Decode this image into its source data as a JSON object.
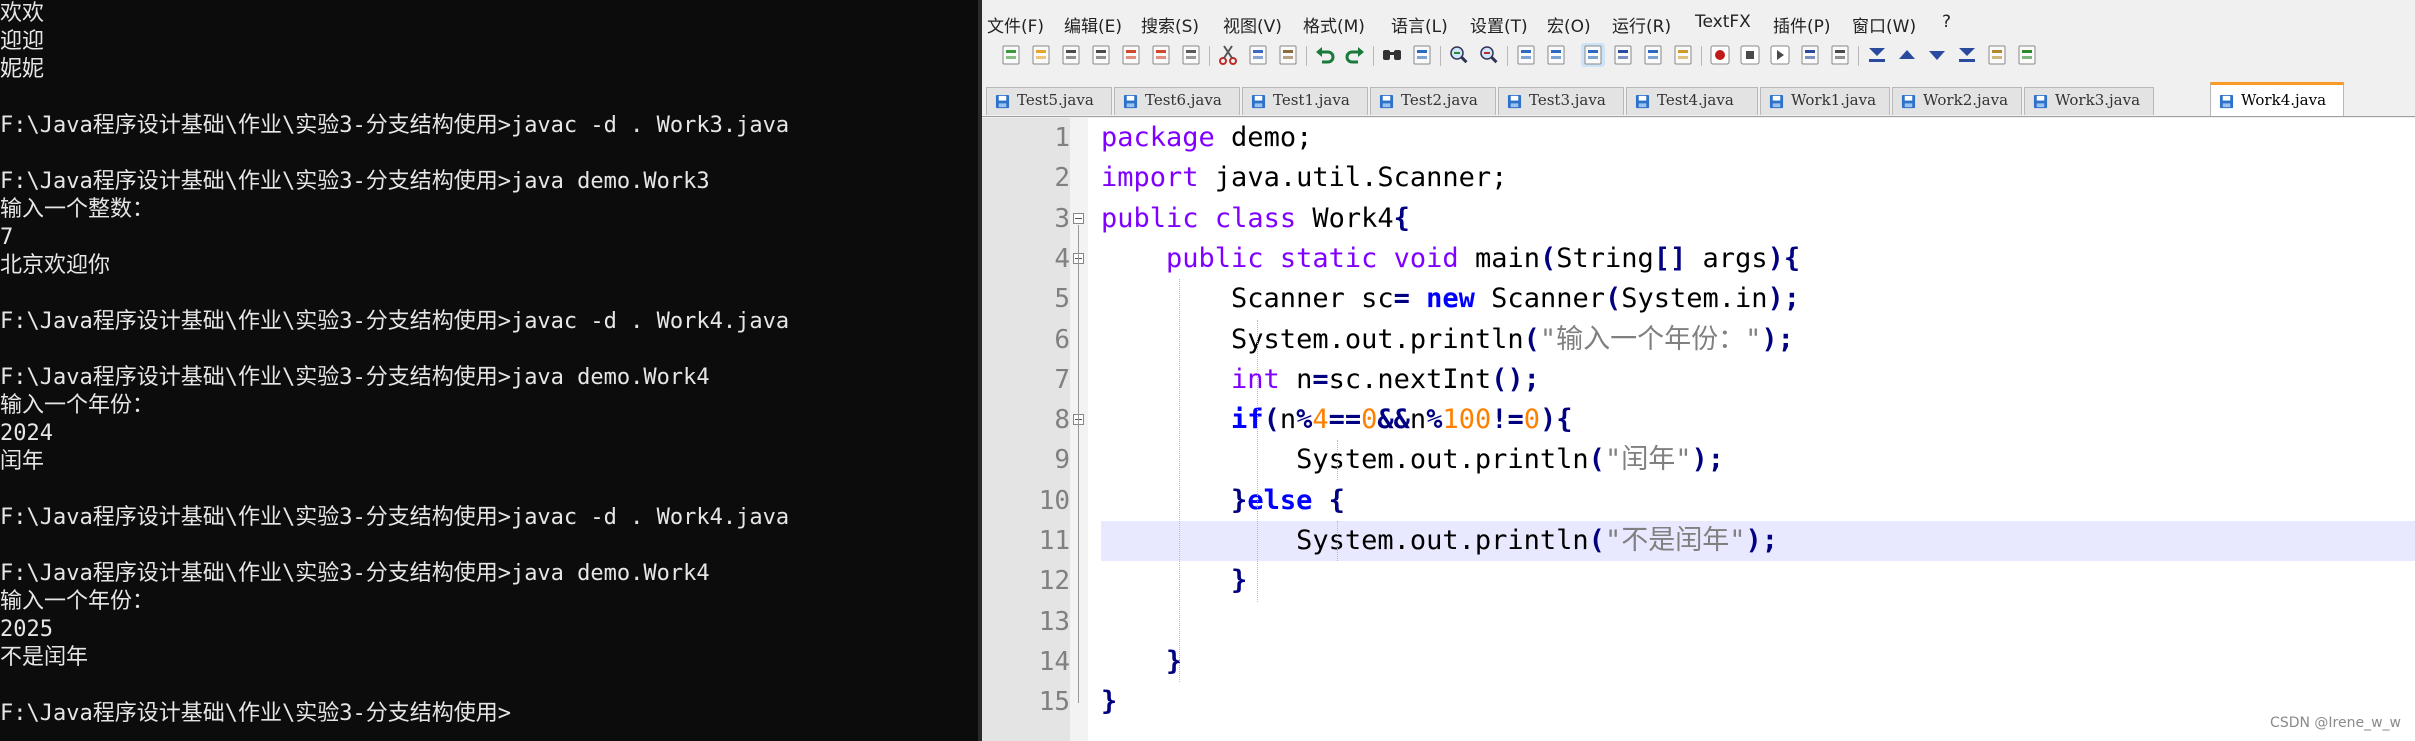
{
  "console": {
    "lines": [
      "欢欢",
      "迎迎",
      "妮妮",
      "",
      "F:\\Java程序设计基础\\作业\\实验3-分支结构使用>javac -d . Work3.java",
      "",
      "F:\\Java程序设计基础\\作业\\实验3-分支结构使用>java demo.Work3",
      "输入一个整数：",
      "7",
      "北京欢迎你",
      "",
      "F:\\Java程序设计基础\\作业\\实验3-分支结构使用>javac -d . Work4.java",
      "",
      "F:\\Java程序设计基础\\作业\\实验3-分支结构使用>java demo.Work4",
      "输入一个年份：",
      "2024",
      "闰年",
      "",
      "F:\\Java程序设计基础\\作业\\实验3-分支结构使用>javac -d . Work4.java",
      "",
      "F:\\Java程序设计基础\\作业\\实验3-分支结构使用>java demo.Work4",
      "输入一个年份：",
      "2025",
      "不是闰年",
      "",
      "F:\\Java程序设计基础\\作业\\实验3-分支结构使用>"
    ]
  },
  "editor": {
    "menu": [
      "文件(F)",
      "编辑(E)",
      "搜索(S)",
      "视图(V)",
      "格式(M)",
      "语言(L)",
      "设置(T)",
      "宏(O)",
      "运行(R)",
      "TextFX",
      "插件(P)",
      "窗口(W)",
      "?"
    ],
    "toolbar": {
      "icons": [
        "new-file-icon",
        "open-file-icon",
        "save-icon",
        "save-all-icon",
        "close-icon",
        "close-all-icon",
        "print-icon",
        "cut-icon",
        "copy-icon",
        "paste-icon",
        "undo-icon",
        "redo-icon",
        "find-icon",
        "replace-icon",
        "zoom-in-icon",
        "zoom-out-icon",
        "sync-vertical-icon",
        "sync-horizontal-icon",
        "word-wrap-icon",
        "show-all-chars-icon",
        "indent-guide-icon",
        "user-language-icon",
        "record-macro-icon",
        "stop-macro-icon",
        "play-macro-icon",
        "run-macro-multiple-icon",
        "save-macro-icon",
        "sort-ascending-icon",
        "up-icon",
        "down-icon",
        "sort-descending-icon",
        "launch-browser-icon",
        "spell-check-icon"
      ]
    },
    "tabs": [
      {
        "label": "Test5.java",
        "active": false
      },
      {
        "label": "Test6.java",
        "active": false
      },
      {
        "label": "Test1.java",
        "active": false
      },
      {
        "label": "Test2.java",
        "active": false
      },
      {
        "label": "Test3.java",
        "active": false
      },
      {
        "label": "Test4.java",
        "active": false
      },
      {
        "label": "Work1.java",
        "active": false
      },
      {
        "label": "Work2.java",
        "active": false
      },
      {
        "label": "Work3.java",
        "active": false
      },
      {
        "label": "Work4.java",
        "active": true
      }
    ],
    "line_numbers": [
      "1",
      "2",
      "3",
      "4",
      "5",
      "6",
      "7",
      "8",
      "9",
      "10",
      "11",
      "12",
      "13",
      "14",
      "15"
    ],
    "code": [
      [
        [
          "kw",
          "package"
        ],
        [
          "t",
          " demo;"
        ]
      ],
      [
        [
          "kw",
          "import"
        ],
        [
          "t",
          " java.util.Scanner;"
        ]
      ],
      [
        [
          "kw",
          "public"
        ],
        [
          "t",
          " "
        ],
        [
          "kw",
          "class"
        ],
        [
          "t",
          " Work4"
        ],
        [
          "op",
          "{"
        ]
      ],
      [
        [
          "t",
          "    "
        ],
        [
          "kw",
          "public"
        ],
        [
          "t",
          " "
        ],
        [
          "kw",
          "static"
        ],
        [
          "t",
          " "
        ],
        [
          "kw",
          "void"
        ],
        [
          "t",
          " main"
        ],
        [
          "op",
          "("
        ],
        [
          "t",
          "String"
        ],
        [
          "op",
          "[]"
        ],
        [
          "t",
          " args"
        ],
        [
          "op",
          "){"
        ]
      ],
      [
        [
          "t",
          "        Scanner sc"
        ],
        [
          "op",
          "="
        ],
        [
          "t",
          " "
        ],
        [
          "kw2",
          "new"
        ],
        [
          "t",
          " Scanner"
        ],
        [
          "op",
          "("
        ],
        [
          "t",
          "System.in"
        ],
        [
          "op",
          ");"
        ]
      ],
      [
        [
          "t",
          "        System.out.println"
        ],
        [
          "op",
          "("
        ],
        [
          "str",
          "\"输入一个年份：\""
        ],
        [
          "op",
          ");"
        ]
      ],
      [
        [
          "t",
          "        "
        ],
        [
          "kw",
          "int"
        ],
        [
          "t",
          " n"
        ],
        [
          "op",
          "="
        ],
        [
          "t",
          "sc.nextInt"
        ],
        [
          "op",
          "();"
        ]
      ],
      [
        [
          "t",
          "        "
        ],
        [
          "kw2",
          "if"
        ],
        [
          "op",
          "("
        ],
        [
          "t",
          "n"
        ],
        [
          "op",
          "%"
        ],
        [
          "num",
          "4"
        ],
        [
          "op",
          "=="
        ],
        [
          "num",
          "0"
        ],
        [
          "op",
          "&&"
        ],
        [
          "t",
          "n"
        ],
        [
          "op",
          "%"
        ],
        [
          "num",
          "100"
        ],
        [
          "op",
          "!="
        ],
        [
          "num",
          "0"
        ],
        [
          "op",
          "){"
        ]
      ],
      [
        [
          "t",
          "            System.out.println"
        ],
        [
          "op",
          "("
        ],
        [
          "str",
          "\"闰年\""
        ],
        [
          "op",
          ");"
        ]
      ],
      [
        [
          "t",
          "        "
        ],
        [
          "op",
          "}"
        ],
        [
          "kw2",
          "else"
        ],
        [
          "t",
          " "
        ],
        [
          "op",
          "{"
        ]
      ],
      [
        [
          "t",
          "            System.out.println"
        ],
        [
          "op",
          "("
        ],
        [
          "str",
          "\"不是闰年\""
        ],
        [
          "op",
          ");"
        ]
      ],
      [
        [
          "t",
          "        "
        ],
        [
          "op",
          "}"
        ]
      ],
      [
        [
          "t",
          ""
        ]
      ],
      [
        [
          "t",
          "    "
        ],
        [
          "op",
          "}"
        ]
      ],
      [
        [
          "op",
          "}"
        ]
      ]
    ],
    "current_line": 11
  },
  "watermark": "CSDN @Irene_w_w"
}
